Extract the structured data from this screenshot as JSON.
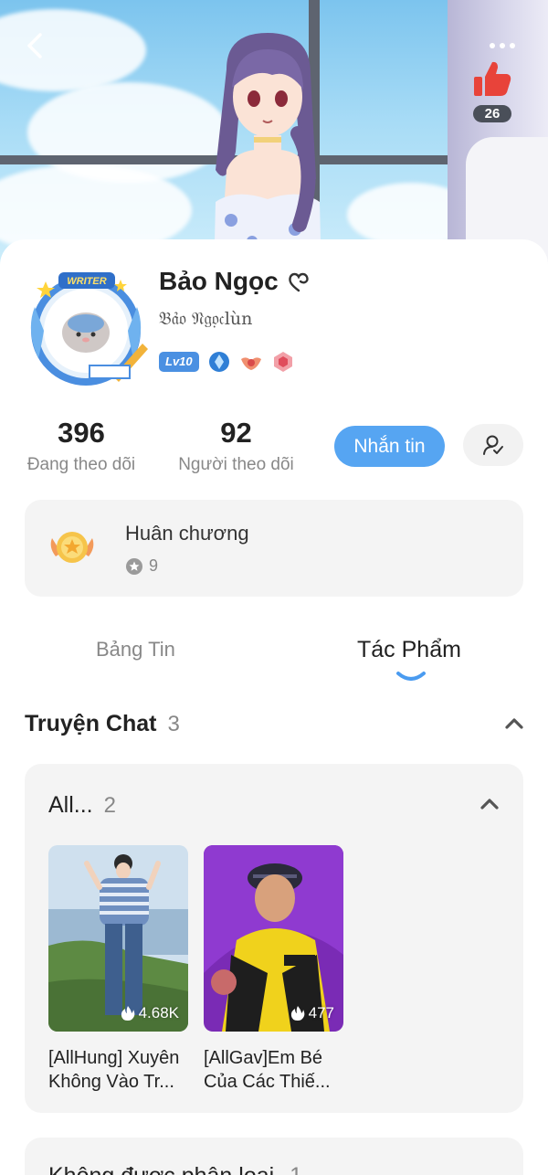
{
  "header": {
    "back_icon": "chevron-left-icon",
    "more_icon": "more-dots-icon",
    "like_icon": "thumbs-up-icon",
    "like_count": "26"
  },
  "profile": {
    "name": "Bảo Ngọc",
    "name_badge_icon": "heart-outline-icon",
    "handle": "𝔅𝔞̉𝔬 𝔑𝔤𝔬̣𝔠lùn",
    "avatar_label": "WRITER",
    "level": "Lv10",
    "badge_icons": [
      "crystal-badge-icon",
      "wings-badge-icon",
      "hexagon-badge-icon"
    ]
  },
  "stats": [
    {
      "value": "396",
      "label": "Đang theo dõi"
    },
    {
      "value": "92",
      "label": "Người theo dõi"
    }
  ],
  "actions": {
    "message_label": "Nhắn tin",
    "follow_icon": "user-check-icon"
  },
  "medals": {
    "title": "Huân chương",
    "count": "9",
    "icon": "medal-icon"
  },
  "tabs": [
    {
      "label": "Bảng Tin",
      "active": false
    },
    {
      "label": "Tác Phẩm",
      "active": true
    }
  ],
  "section": {
    "title": "Truyện Chat",
    "count": "3"
  },
  "groups": [
    {
      "title": "All...",
      "count": "2",
      "stories": [
        {
          "title": "[AllHung] Xuyên Không Vào Tr...",
          "views": "4.68K"
        },
        {
          "title": "[AllGav]Em Bé Của Các Thiế...",
          "views": "477"
        }
      ]
    },
    {
      "title": "Không được phân loại",
      "count": "1"
    }
  ],
  "colors": {
    "accent": "#56a5f2",
    "like_red": "#e8433a",
    "card_bg": "#f4f4f4"
  }
}
